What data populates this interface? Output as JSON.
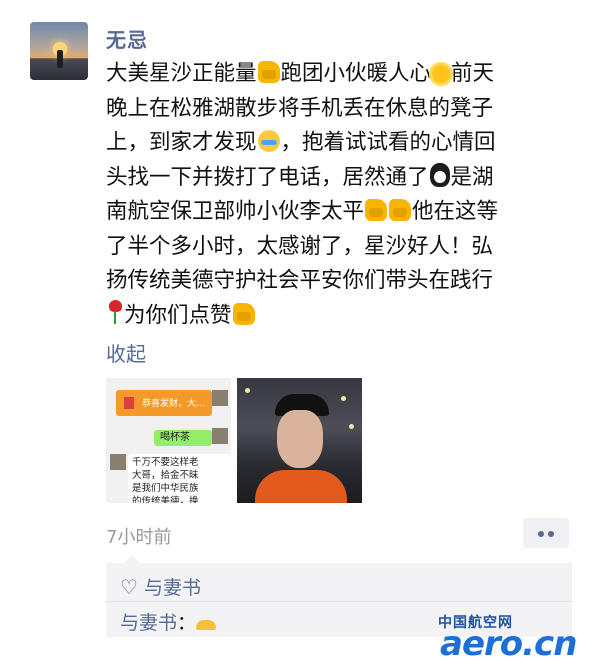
{
  "post": {
    "author": "无忌",
    "lines": [
      "大美星沙正能量",
      "跑团小伙暖人心",
      "前天",
      "晚上在松雅湖散步将手机丢在休息的凳子",
      "上，到家才发现",
      "，抱着试试看的心情回",
      "头找一下并拨打了电话，居然通了",
      "是湖",
      "南航空保卫部帅小伙李太平",
      "他在这等",
      "了半个多小时，太感谢了，星沙好人！弘",
      "扬传统美德守护社会平安你们带头在践行",
      "为你们点赞"
    ],
    "emoji": [
      "thumbs-up",
      "sun",
      "crying-laughing",
      "penguin",
      "thumbs-up",
      "rose"
    ],
    "collapse_label": "收起",
    "timestamp": "7小时前"
  },
  "photos": [
    {
      "kind": "chat-screenshot",
      "red_packet_text": "恭喜发财，大…",
      "reply_text": "喝杯茶",
      "message_text": [
        "千万不要这样老",
        "大哥，拾金不昧",
        "是我们中华民族",
        "的传统美德，换"
      ]
    },
    {
      "kind": "selfie"
    }
  ],
  "interactions": {
    "likes": [
      "与妻书"
    ],
    "comments": [
      {
        "author": "与妻书",
        "separator": "："
      }
    ]
  },
  "watermark": {
    "cn": "中国航空网",
    "en": "aero.cn"
  },
  "colors": {
    "link": "#576b95",
    "timestamp": "#9a9a9a",
    "likes_bg": "#f3f3f5"
  }
}
